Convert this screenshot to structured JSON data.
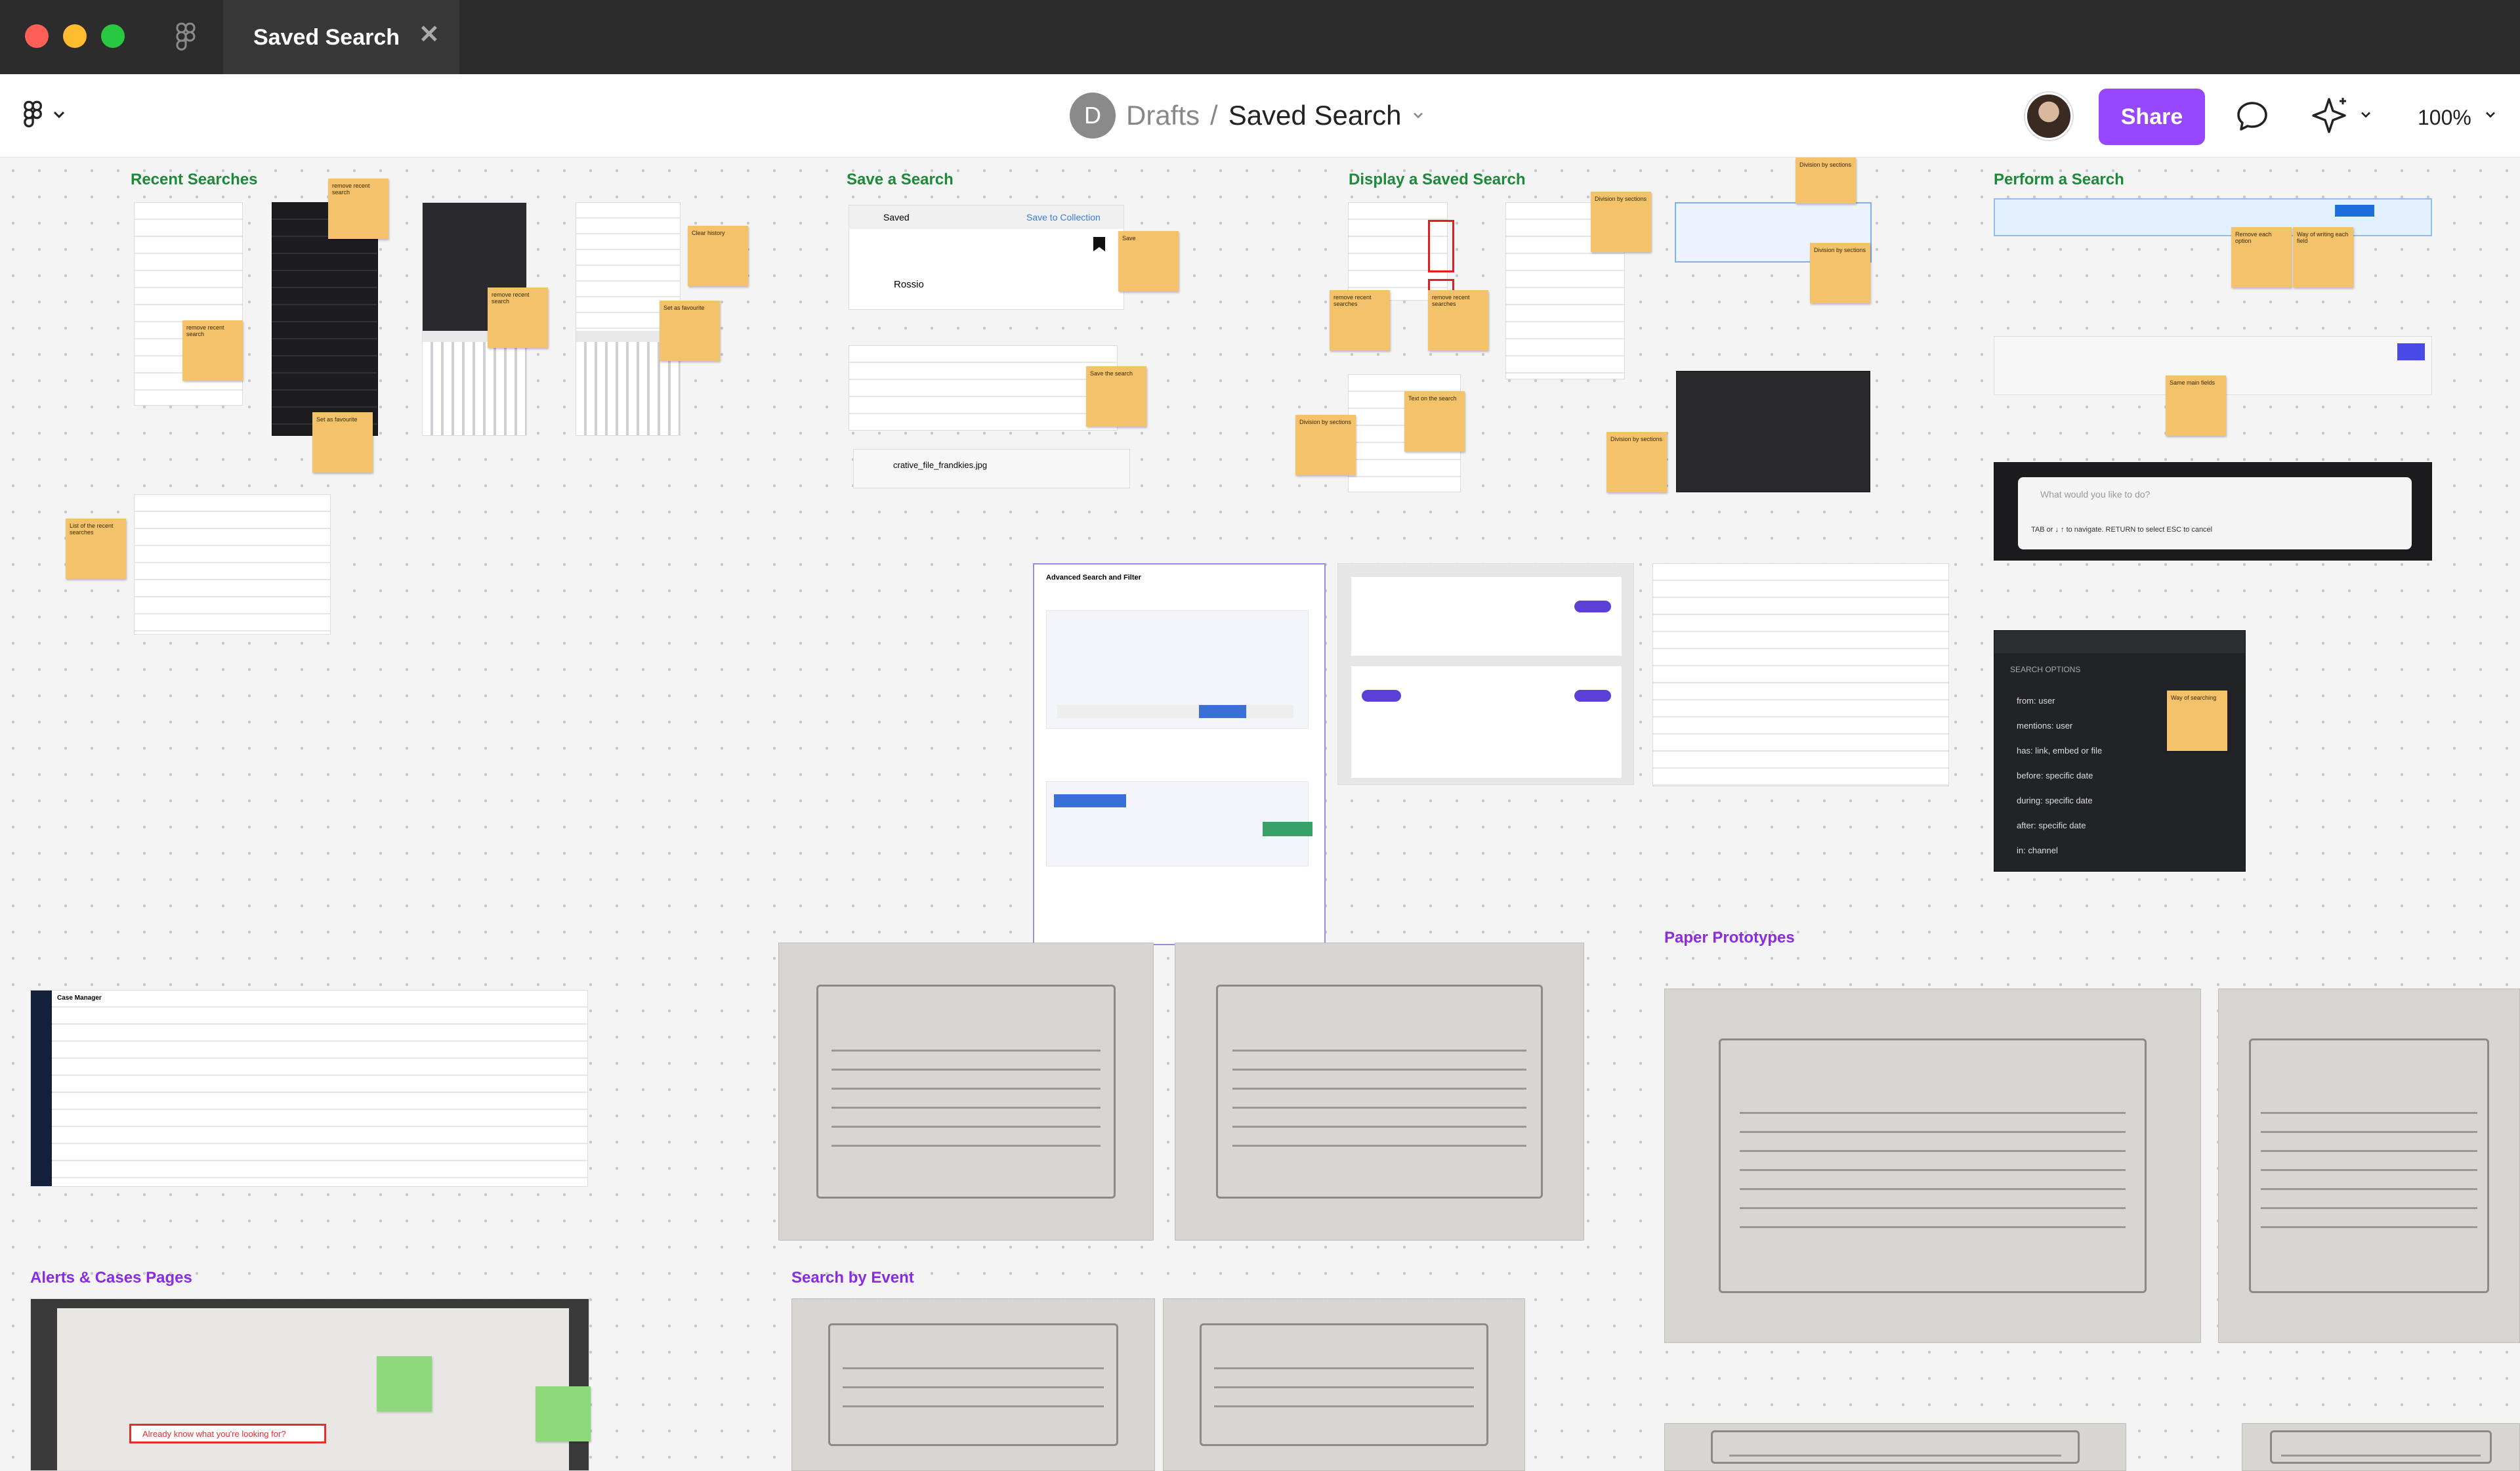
{
  "window": {
    "tab_title": "Saved Search",
    "close_glyph": "✕"
  },
  "toolbar": {
    "breadcrumb": {
      "avatar_letter": "D",
      "parent": "Drafts",
      "separator": "/",
      "current": "Saved Search"
    },
    "share_label": "Share",
    "zoom_label": "100%"
  },
  "colors": {
    "accent": "#9747ff",
    "titlebar": "#2c2c2c",
    "close": "#ff5f57",
    "minimize": "#febc2e",
    "maximize": "#28c840",
    "sticky": "#f3c26b"
  },
  "icons": [
    "figma-logo-icon",
    "chevron-down-icon",
    "comment-icon",
    "sparkle-ai-icon",
    "close-icon"
  ],
  "canvas": {
    "sections": {
      "recent_searches": "Recent Searches",
      "save_a_search": "Save a Search",
      "display_saved_search": "Display a Saved Search",
      "perform_a_search": "Perform a Search",
      "paper_prototypes": "Paper Prototypes",
      "alerts_cases": "Alerts & Cases Pages",
      "search_by_event": "Search by Event"
    },
    "notes": {
      "remove_recent_search": "remove recent search",
      "set_as_favourite": "Set as favourite",
      "clear_history": "Clear history",
      "save": "Save",
      "save_the_search": "Save the search",
      "list_recent_searches": "List of the recent searches",
      "division_by_sections": "Division by sections",
      "text_on_the_search": "Text on the search",
      "remove_recent_searches": "remove recent searches",
      "remove_each_option": "Remove each option",
      "way_of_writing_each_field": "Way of writing each field",
      "same_main_fields": "Same main fields",
      "way_of_searching": "Way of searching"
    },
    "screens": {
      "saved_header": "Saved",
      "save_to_collection": "Save to Collection",
      "rossio": "Rossio",
      "file_name": "crative_file_frandkies.jpg",
      "search_prompt": "What would you like to do?",
      "nav_hint": "TAB or ↓ ↑ to navigate.  RETURN to select  ESC to cancel",
      "search_options_title": "SEARCH OPTIONS",
      "search_options": [
        "from: user",
        "mentions: user",
        "has: link, embed or file",
        "before: specific date",
        "during: specific date",
        "after: specific date",
        "in: channel"
      ],
      "advanced_search_title": "Advanced Search and Filter",
      "case_manager_title": "Case Manager",
      "already_know": "Already know what you're looking for?"
    }
  }
}
